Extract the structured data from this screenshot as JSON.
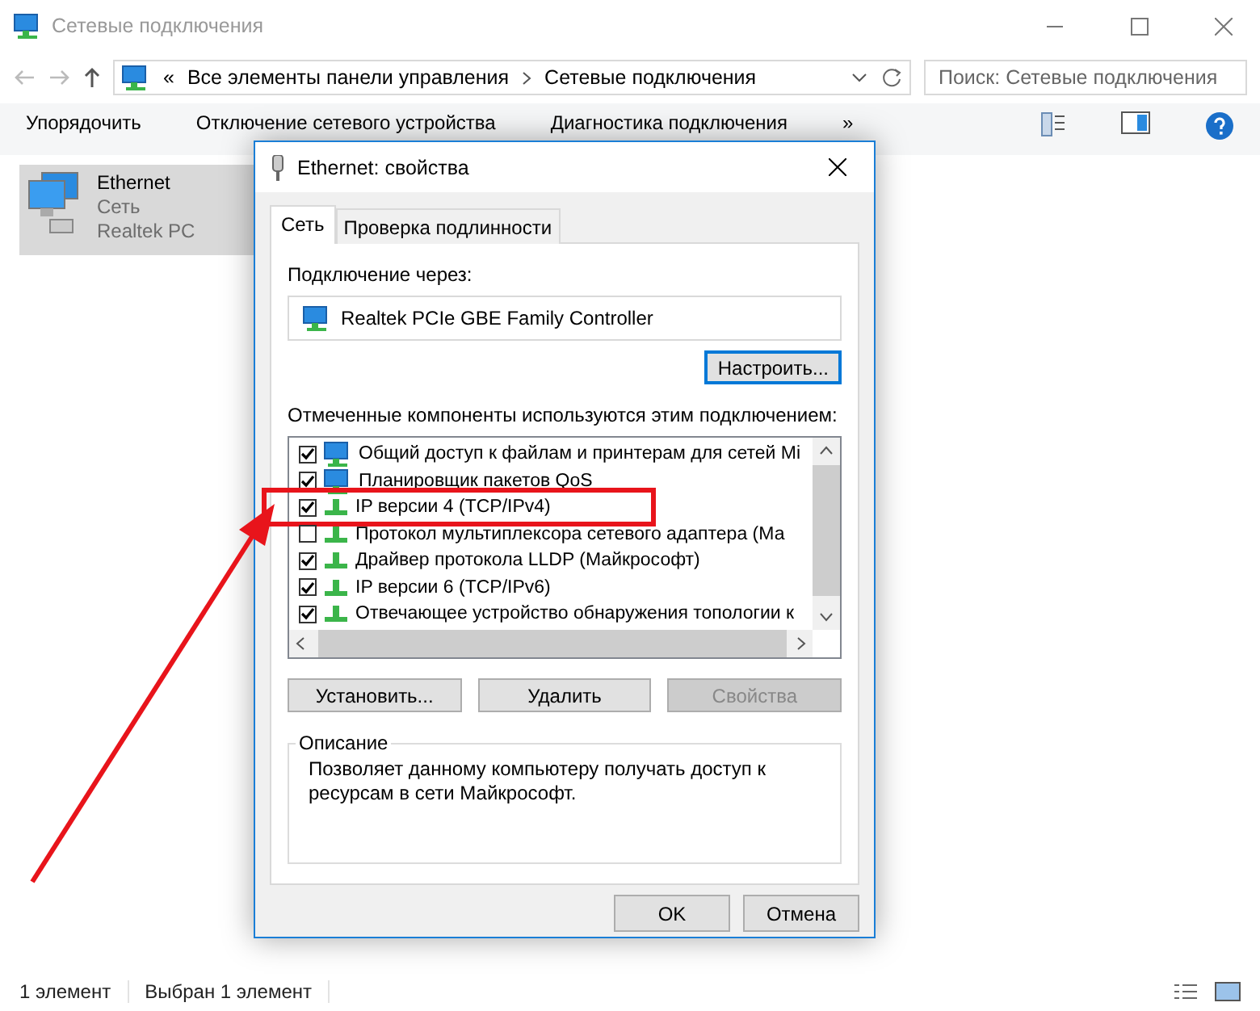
{
  "window": {
    "title": "Сетевые подключения"
  },
  "address": {
    "overflow": "«",
    "crumbs": [
      "Все элементы панели управления",
      "Сетевые подключения"
    ]
  },
  "search": {
    "placeholder": "Поиск: Сетевые подключения"
  },
  "toolbar": [
    "Упорядочить",
    "Отключение сетевого устройства",
    "Диагностика подключения",
    "»"
  ],
  "items": [
    {
      "name": "Ethernet",
      "lines": [
        "Сеть",
        "Realtek PC"
      ],
      "selected": true
    }
  ],
  "status_bar": [
    "1 элемент",
    "Выбран 1 элемент"
  ],
  "dialog": {
    "title": "Ethernet: свойства",
    "tabs": [
      {
        "label": "Сеть",
        "selected": true
      },
      {
        "label": "Проверка подлинности",
        "selected": false
      }
    ],
    "connect_label": "Подключение через:",
    "adapter": "Realtek PCIe GBE Family Controller",
    "configure_button": "Настроить...",
    "components_label": "Отмеченные компоненты используются этим подключением:",
    "components": [
      {
        "label": "Общий доступ к файлам и принтерам для сетей Mi",
        "checked": true,
        "kind": "service",
        "highlighted": false
      },
      {
        "label": "Планировщик пакетов QoS",
        "checked": true,
        "kind": "service",
        "highlighted": false
      },
      {
        "label": "IP версии 4 (TCP/IPv4)",
        "checked": true,
        "kind": "protocol",
        "highlighted": true
      },
      {
        "label": "Протокол мультиплексора сетевого адаптера (Ма",
        "checked": false,
        "kind": "protocol",
        "highlighted": false
      },
      {
        "label": "Драйвер протокола LLDP (Майкрософт)",
        "checked": true,
        "kind": "protocol",
        "highlighted": false
      },
      {
        "label": "IP версии 6 (TCP/IPv6)",
        "checked": true,
        "kind": "protocol",
        "highlighted": false
      },
      {
        "label": "Отвечающее устройство обнаружения топологии к",
        "checked": true,
        "kind": "protocol",
        "highlighted": false
      }
    ],
    "actions": [
      {
        "label": "Установить...",
        "disabled": false
      },
      {
        "label": "Удалить",
        "disabled": false
      },
      {
        "label": "Свойства",
        "disabled": true
      }
    ],
    "description_title": "Описание",
    "description": "Позволяет данному компьютеру получать доступ к ресурсам в сети Майкрософт.",
    "footer": [
      {
        "label": "OK",
        "disabled": false
      },
      {
        "label": "Отмена",
        "disabled": false
      }
    ]
  }
}
